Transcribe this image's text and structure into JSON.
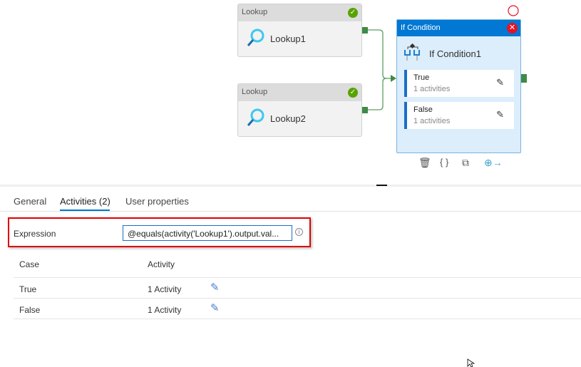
{
  "canvas": {
    "lookup_nodes": [
      {
        "type": "Lookup",
        "name": "Lookup1",
        "status": "success"
      },
      {
        "type": "Lookup",
        "name": "Lookup2",
        "status": "success"
      }
    ],
    "if_node": {
      "type": "If Condition",
      "name": "If Condition1",
      "cases": [
        {
          "label": "True",
          "count": "1 activities"
        },
        {
          "label": "False",
          "count": "1 activities"
        }
      ],
      "toolbar": [
        "delete-icon",
        "code-icon",
        "copy-icon",
        "add-output-icon"
      ]
    }
  },
  "tabs": [
    {
      "label": "General"
    },
    {
      "label": "Activities (2)",
      "active": true
    },
    {
      "label": "User properties"
    }
  ],
  "expression": {
    "label": "Expression",
    "value": "@equals(activity('Lookup1').output.val..."
  },
  "table": {
    "headers": [
      "Case",
      "Activity"
    ],
    "rows": [
      {
        "case": "True",
        "activity": "1 Activity"
      },
      {
        "case": "False",
        "activity": "1 Activity"
      }
    ]
  },
  "colors": {
    "accent": "#0078d4",
    "success": "#57a300",
    "error": "#e81123",
    "highlight": "#e00000"
  }
}
